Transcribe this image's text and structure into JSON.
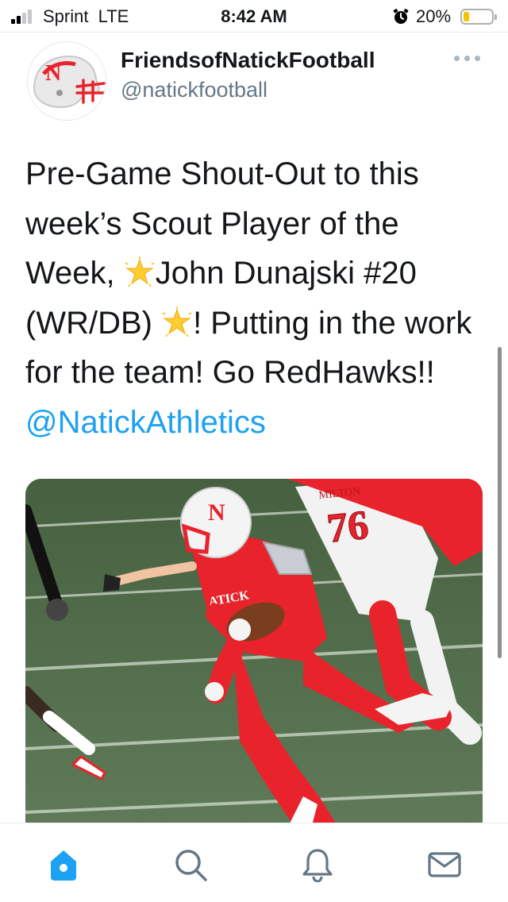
{
  "status_bar": {
    "carrier": "Sprint",
    "network": "LTE",
    "time": "8:42 AM",
    "battery_percent": "20%",
    "battery_level": 0.2,
    "battery_color": "#f5c400"
  },
  "tweet": {
    "display_name": "FriendsofNatickFootball",
    "handle": "@natickfootball",
    "text_part1": "Pre-Game Shout-Out to this week’s Scout Player of the Week, ",
    "text_part2": "John Dunajski #20 (WR/DB) ",
    "text_part3": "!  Putting in the work for the team!  Go RedHawks!! ",
    "mention": "@NatickAthletics",
    "emoji_name": "glowing-star",
    "avatar_icon": "natick-helmet-logo",
    "avatar_letter": "N",
    "media_jersey_text_1": "ATICK",
    "media_jersey_text_2": "MILTON",
    "media_jersey_number": "76",
    "media_helmet_letter": "N"
  },
  "nav": {
    "items": [
      "home-icon",
      "search-icon",
      "notifications-icon",
      "messages-icon"
    ],
    "active": "home-icon"
  },
  "colors": {
    "accent": "#1da1f2",
    "secondary_text": "#657786",
    "natick_red": "#e8232b"
  }
}
